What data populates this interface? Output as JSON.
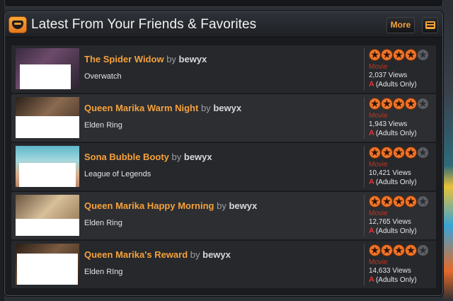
{
  "panel": {
    "title": "Latest From Your Friends & Favorites",
    "more_label": "More",
    "header_icon": "grinning-face-icon",
    "rss_icon": "feed-icon"
  },
  "colors": {
    "accent": "#f5a13b",
    "type_color": "#c4361a",
    "adults_color": "#e23434"
  },
  "items": [
    {
      "title": "The Spider Widow",
      "by": "by",
      "author": "bewyx",
      "game": "Overwatch",
      "stars": 4,
      "max_stars": 5,
      "type": "Movie",
      "views": "2,037 Views",
      "rating_letter": "A",
      "rating_text": "(Adults Only)"
    },
    {
      "title": "Queen Marika Warm Night",
      "by": "by",
      "author": "bewyx",
      "game": "Elden Ring",
      "stars": 4,
      "max_stars": 5,
      "type": "Movie",
      "views": "1,943 Views",
      "rating_letter": "A",
      "rating_text": "(Adults Only)"
    },
    {
      "title": "Sona Bubble Booty",
      "by": "by",
      "author": "bewyx",
      "game": "League of Legends",
      "stars": 4,
      "max_stars": 5,
      "type": "Movie",
      "views": "10,421 Views",
      "rating_letter": "A",
      "rating_text": "(Adults Only)"
    },
    {
      "title": "Queen Marika Happy Morning",
      "by": "by",
      "author": "bewyx",
      "game": "Elden Ring",
      "stars": 4,
      "max_stars": 5,
      "type": "Movie",
      "views": "12,765 Views",
      "rating_letter": "A",
      "rating_text": "(Adults Only)"
    },
    {
      "title": "Queen Marika's Reward",
      "by": "by",
      "author": "bewyx",
      "game": "Elden RIng",
      "stars": 4,
      "max_stars": 5,
      "type": "Movie",
      "views": "14,633 Views",
      "rating_letter": "A",
      "rating_text": "(Adults Only)"
    }
  ]
}
